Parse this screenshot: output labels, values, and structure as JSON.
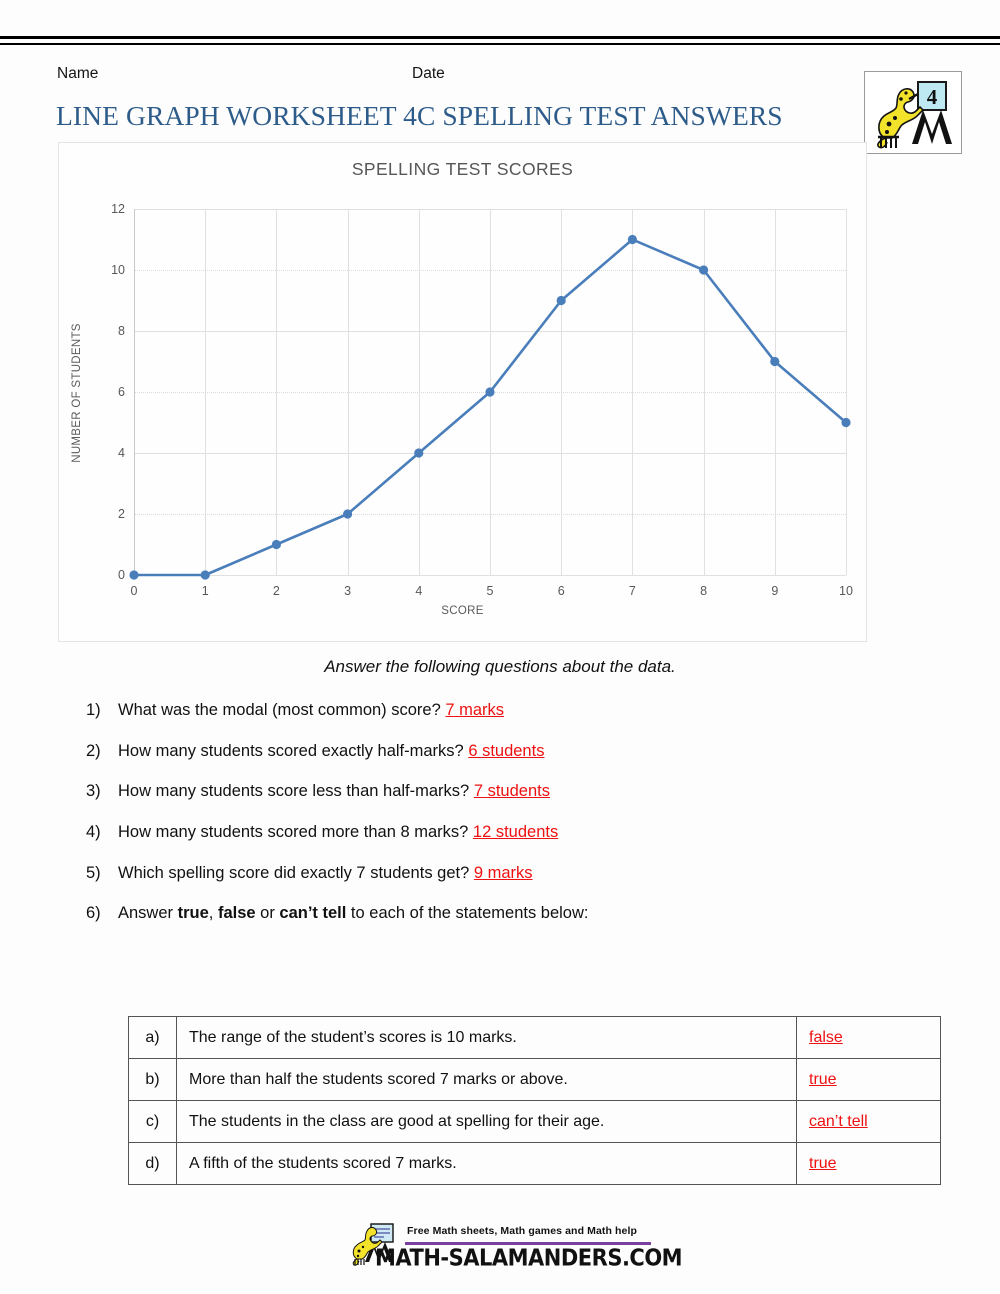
{
  "header": {
    "name_label": "Name",
    "date_label": "Date",
    "title": "LINE GRAPH WORKSHEET 4C SPELLING TEST ANSWERS",
    "title_color": "#2e5c8a",
    "badge_number": "4"
  },
  "chart_data": {
    "type": "line",
    "title": "SPELLING TEST SCORES",
    "xlabel": "SCORE",
    "ylabel": "NUMBER OF STUDENTS",
    "x": [
      0,
      1,
      2,
      3,
      4,
      5,
      6,
      7,
      8,
      9,
      10
    ],
    "values": [
      0,
      0,
      1,
      2,
      4,
      6,
      9,
      11,
      10,
      7,
      5
    ],
    "xticks": [
      "0",
      "1",
      "2",
      "3",
      "4",
      "5",
      "6",
      "7",
      "8",
      "9",
      "10"
    ],
    "yticks": [
      "0",
      "2",
      "4",
      "6",
      "8",
      "10",
      "12"
    ],
    "xlim": [
      0,
      10
    ],
    "ylim": [
      0,
      12
    ],
    "grid": true,
    "legend": "none",
    "series_color": "#4a7ebb",
    "marker": "circle"
  },
  "instruction": "Answer the following questions about the data.",
  "questions": [
    {
      "num": "1)",
      "text": "What was the modal (most common) score? ",
      "answer": "7 marks"
    },
    {
      "num": "2)",
      "text": "How many students scored exactly half-marks? ",
      "answer": "6 students"
    },
    {
      "num": "3)",
      "text": "How many students score less than half-marks? ",
      "answer": "7 students"
    },
    {
      "num": "4)",
      "text": "How many students scored more than 8 marks? ",
      "answer": "12 students"
    },
    {
      "num": "5)",
      "text": "Which spelling score did exactly 7 students get? ",
      "answer": "9 marks"
    }
  ],
  "question6": {
    "num": "6)",
    "lead": "Answer ",
    "bold1": "true",
    "sep1": ", ",
    "bold2": "false",
    "sep2": " or ",
    "bold3": "can’t tell",
    "tail": " to each of the statements below:"
  },
  "statements": [
    {
      "letter": "a)",
      "text": "The range of the student’s scores is 10 marks.",
      "answer": "false"
    },
    {
      "letter": "b)",
      "text": "More than half the students scored 7 marks or above.",
      "answer": "true"
    },
    {
      "letter": "c)",
      "text": "The students in the class are good at spelling for their age.",
      "answer": "can’t tell"
    },
    {
      "letter": "d)",
      "text": "A fifth of the students scored 7 marks.",
      "answer": "true"
    }
  ],
  "footer": {
    "tagline": "Free Math sheets, Math games and Math help",
    "site": "MATH-SALAMANDERS.COM",
    "rule_color": "#7b3fa0"
  },
  "answer_color": "#ee1111"
}
